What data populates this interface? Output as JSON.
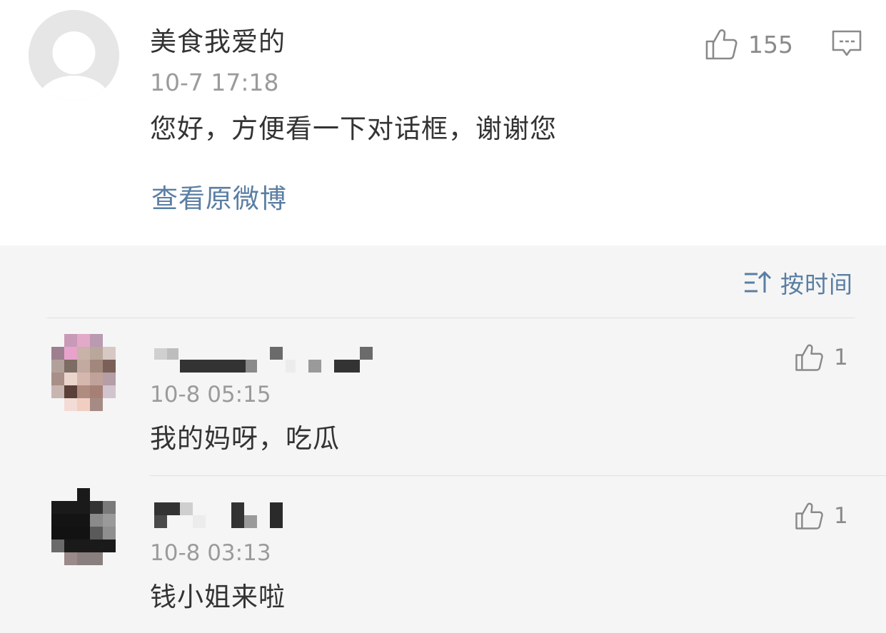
{
  "post": {
    "username": "美食我爱的",
    "time": "10-7 17:18",
    "text": "您好，方便看一下对话框，谢谢您",
    "view_original": "查看原微博",
    "like_count": "155",
    "icons": [
      "avatar-placeholder-icon",
      "thumbs-up-icon",
      "comment-icon"
    ]
  },
  "sort": {
    "label": "按时间",
    "icon": "sort-icon"
  },
  "replies": [
    {
      "time": "10-8 05:15",
      "text": "我的妈呀，吃瓜",
      "like_count": "1"
    },
    {
      "time": "10-8 03:13",
      "text": "钱小姐来啦",
      "like_count": "1"
    }
  ],
  "colors": {
    "link": "#5a7ea3",
    "secondary_text": "#9b9b9b",
    "section_bg": "#f5f5f5"
  }
}
